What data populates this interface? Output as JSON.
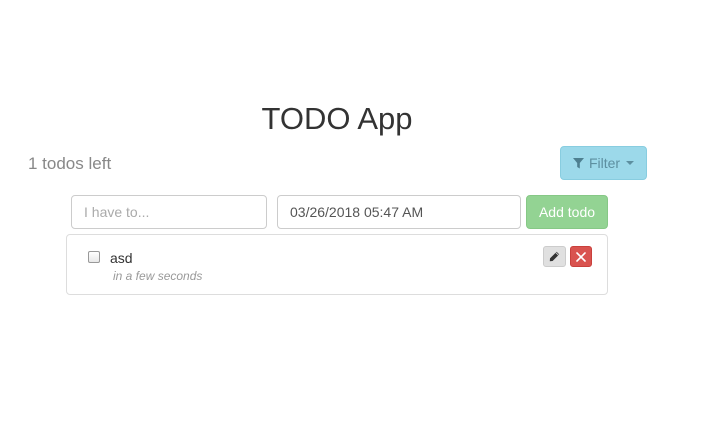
{
  "app": {
    "title": "TODO App"
  },
  "status": {
    "todos_left": "1 todos left"
  },
  "filter": {
    "label": "Filter",
    "icon": "funnel-icon"
  },
  "form": {
    "todo_placeholder": "I have to...",
    "todo_value": "",
    "date_value": "03/26/2018 05:47 AM",
    "add_label": "Add todo"
  },
  "todos": [
    {
      "text": "asd",
      "time": "in a few seconds",
      "completed": false,
      "edit_icon": "pencil-icon",
      "delete_icon": "close-icon"
    }
  ],
  "colors": {
    "filter_bg": "#9cd9ea",
    "add_bg": "#93d393",
    "delete_bg": "#d9534f",
    "edit_bg": "#e0e0e0"
  }
}
